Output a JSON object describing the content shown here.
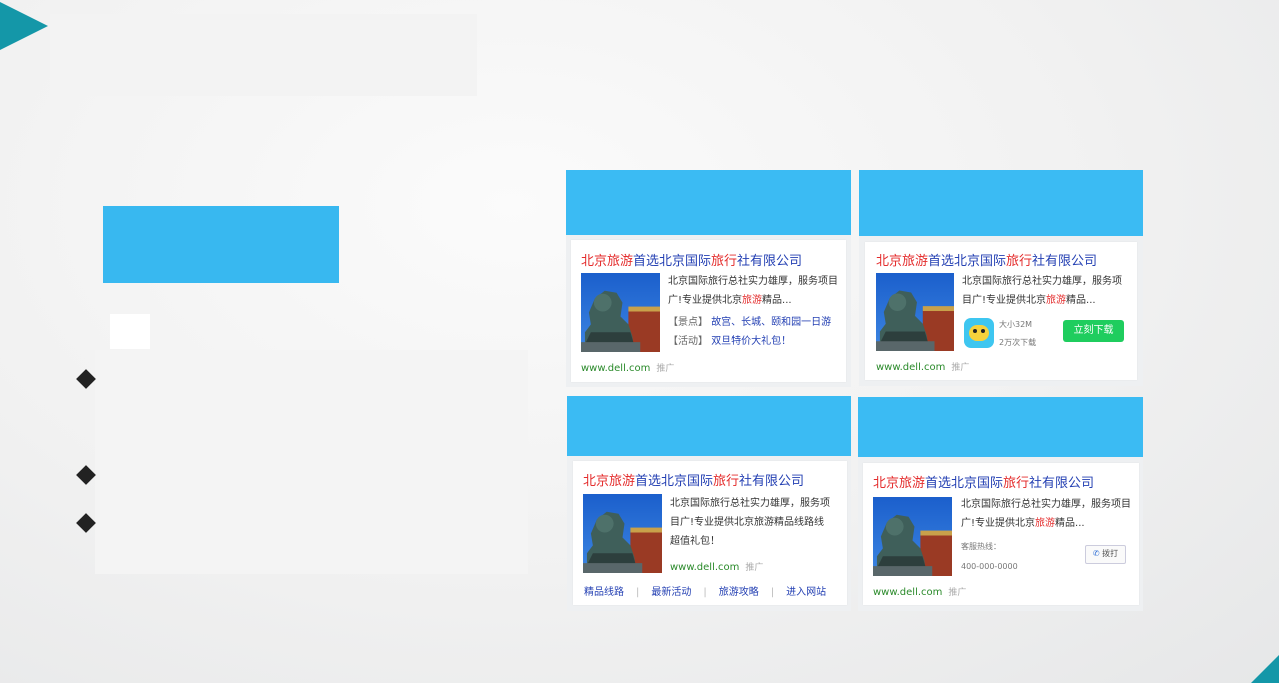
{
  "ad": {
    "title_parts": [
      "北京旅游",
      "首选北京国际",
      "旅行",
      "社有限公司"
    ],
    "desc_long": "北京国际旅行总社实力雄厚，服务项目广!专业提供北京旅游精品线路线超值礼包！",
    "desc_a": "北京国际旅行总社实力雄厚，服务项目广!专业提供北京",
    "desc_kw": "旅游",
    "desc_end": "精品...",
    "url": "www.dell.com",
    "promo": "推广",
    "spots_label": "【景点】",
    "spots": "故宫、长城、颐和园一日游",
    "activity_label": "【活动】",
    "activity": "双旦特价大礼包！",
    "app_size": "大小32M",
    "app_downloads": "2万次下载",
    "download_btn": "立刻下载",
    "hotline_label": "客服热线：",
    "hotline": "400-000-0000",
    "call_btn": "拨打",
    "links": [
      "精品线路",
      "最新活动",
      "旅游攻略",
      "进入网站"
    ]
  },
  "colors": {
    "accent": "#1497a8",
    "block_blue": "#38b8f0",
    "header_blue": "#3bbbf3",
    "red": "#e42c2c",
    "link_blue": "#2440b3",
    "green": "#1fcd5e"
  },
  "icons": [
    "diamond-bullet",
    "app-icon",
    "phone-icon",
    "lion-statue-image"
  ]
}
